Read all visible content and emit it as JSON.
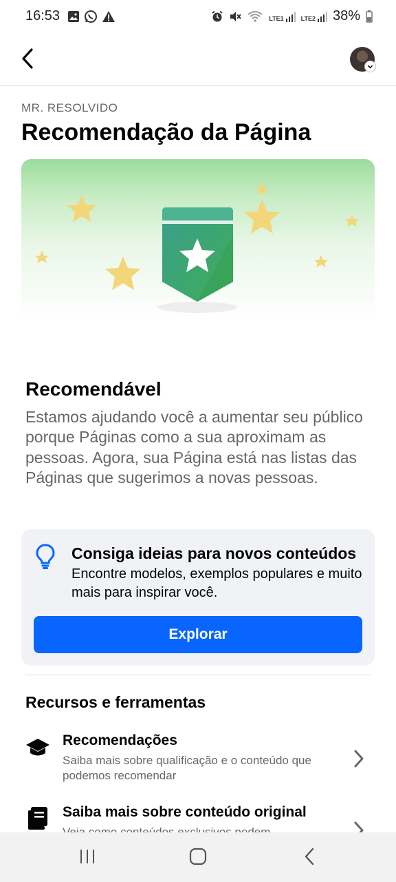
{
  "status_bar": {
    "time": "16:53",
    "battery": "38%",
    "sim1": "LTE1",
    "sim2": "LTE2"
  },
  "header": {
    "back_icon": "chevron-left-icon",
    "avatar_icon": "profile-avatar"
  },
  "page": {
    "kicker": "MR. RESOLVIDO",
    "title": "Recomendação da Página"
  },
  "hero": {
    "illustration": "ribbon-star-badge",
    "colors": {
      "badge_top": "#3a9e8c",
      "badge_bottom": "#40ad58",
      "star": "#f3d67a"
    }
  },
  "status_section": {
    "heading": "Recomendável",
    "body": "Estamos ajudando você a aumentar seu público porque Páginas como a sua aproximam as pessoas. Agora, sua Página está nas listas das Páginas que sugerimos a novas pessoas."
  },
  "ideas_card": {
    "icon": "lightbulb-icon",
    "title": "Consiga ideias para novos conteúdos",
    "body": "Encontre modelos, exemplos populares e muito mais para inspirar você.",
    "button_label": "Explorar",
    "button_color": "#0866ff"
  },
  "tools": {
    "heading": "Recursos e ferramentas",
    "items": [
      {
        "icon": "graduation-cap-icon",
        "title": "Recomendações",
        "description": "Saiba mais sobre qualificação e o conteúdo que podemos recomendar"
      },
      {
        "icon": "book-icon",
        "title": "Saiba mais sobre conteúdo original",
        "description": "Veja como conteúdos exclusivos podem"
      }
    ]
  },
  "nav_bar": {
    "recents_icon": "recents-icon",
    "home_icon": "home-icon",
    "back_icon": "back-icon"
  }
}
